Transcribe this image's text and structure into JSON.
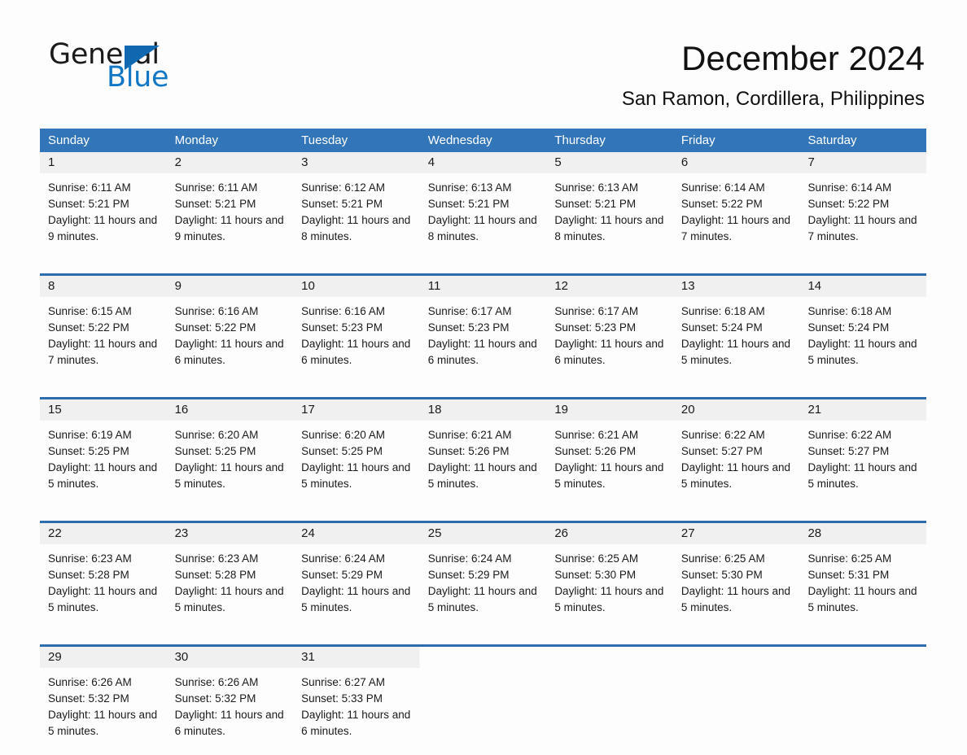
{
  "logo": {
    "word1": "General",
    "word2": "Blue",
    "triangle_color": "#1068b1",
    "blue_text_color": "#1278c6"
  },
  "header": {
    "title": "December 2024",
    "subtitle": "San Ramon, Cordillera, Philippines"
  },
  "theme": {
    "header_blue": "#3275b8",
    "week_rule_blue": "#2d6cad",
    "daynum_band": "#f0f0f0",
    "page_bg": "#fdfdfd"
  },
  "weekdays": [
    "Sunday",
    "Monday",
    "Tuesday",
    "Wednesday",
    "Thursday",
    "Friday",
    "Saturday"
  ],
  "weeks": [
    {
      "days": [
        {
          "num": "1",
          "sunrise": "Sunrise: 6:11 AM",
          "sunset": "Sunset: 5:21 PM",
          "daylight": "Daylight: 11 hours and 9 minutes."
        },
        {
          "num": "2",
          "sunrise": "Sunrise: 6:11 AM",
          "sunset": "Sunset: 5:21 PM",
          "daylight": "Daylight: 11 hours and 9 minutes."
        },
        {
          "num": "3",
          "sunrise": "Sunrise: 6:12 AM",
          "sunset": "Sunset: 5:21 PM",
          "daylight": "Daylight: 11 hours and 8 minutes."
        },
        {
          "num": "4",
          "sunrise": "Sunrise: 6:13 AM",
          "sunset": "Sunset: 5:21 PM",
          "daylight": "Daylight: 11 hours and 8 minutes."
        },
        {
          "num": "5",
          "sunrise": "Sunrise: 6:13 AM",
          "sunset": "Sunset: 5:21 PM",
          "daylight": "Daylight: 11 hours and 8 minutes."
        },
        {
          "num": "6",
          "sunrise": "Sunrise: 6:14 AM",
          "sunset": "Sunset: 5:22 PM",
          "daylight": "Daylight: 11 hours and 7 minutes."
        },
        {
          "num": "7",
          "sunrise": "Sunrise: 6:14 AM",
          "sunset": "Sunset: 5:22 PM",
          "daylight": "Daylight: 11 hours and 7 minutes."
        }
      ]
    },
    {
      "days": [
        {
          "num": "8",
          "sunrise": "Sunrise: 6:15 AM",
          "sunset": "Sunset: 5:22 PM",
          "daylight": "Daylight: 11 hours and 7 minutes."
        },
        {
          "num": "9",
          "sunrise": "Sunrise: 6:16 AM",
          "sunset": "Sunset: 5:22 PM",
          "daylight": "Daylight: 11 hours and 6 minutes."
        },
        {
          "num": "10",
          "sunrise": "Sunrise: 6:16 AM",
          "sunset": "Sunset: 5:23 PM",
          "daylight": "Daylight: 11 hours and 6 minutes."
        },
        {
          "num": "11",
          "sunrise": "Sunrise: 6:17 AM",
          "sunset": "Sunset: 5:23 PM",
          "daylight": "Daylight: 11 hours and 6 minutes."
        },
        {
          "num": "12",
          "sunrise": "Sunrise: 6:17 AM",
          "sunset": "Sunset: 5:23 PM",
          "daylight": "Daylight: 11 hours and 6 minutes."
        },
        {
          "num": "13",
          "sunrise": "Sunrise: 6:18 AM",
          "sunset": "Sunset: 5:24 PM",
          "daylight": "Daylight: 11 hours and 5 minutes."
        },
        {
          "num": "14",
          "sunrise": "Sunrise: 6:18 AM",
          "sunset": "Sunset: 5:24 PM",
          "daylight": "Daylight: 11 hours and 5 minutes."
        }
      ]
    },
    {
      "days": [
        {
          "num": "15",
          "sunrise": "Sunrise: 6:19 AM",
          "sunset": "Sunset: 5:25 PM",
          "daylight": "Daylight: 11 hours and 5 minutes."
        },
        {
          "num": "16",
          "sunrise": "Sunrise: 6:20 AM",
          "sunset": "Sunset: 5:25 PM",
          "daylight": "Daylight: 11 hours and 5 minutes."
        },
        {
          "num": "17",
          "sunrise": "Sunrise: 6:20 AM",
          "sunset": "Sunset: 5:25 PM",
          "daylight": "Daylight: 11 hours and 5 minutes."
        },
        {
          "num": "18",
          "sunrise": "Sunrise: 6:21 AM",
          "sunset": "Sunset: 5:26 PM",
          "daylight": "Daylight: 11 hours and 5 minutes."
        },
        {
          "num": "19",
          "sunrise": "Sunrise: 6:21 AM",
          "sunset": "Sunset: 5:26 PM",
          "daylight": "Daylight: 11 hours and 5 minutes."
        },
        {
          "num": "20",
          "sunrise": "Sunrise: 6:22 AM",
          "sunset": "Sunset: 5:27 PM",
          "daylight": "Daylight: 11 hours and 5 minutes."
        },
        {
          "num": "21",
          "sunrise": "Sunrise: 6:22 AM",
          "sunset": "Sunset: 5:27 PM",
          "daylight": "Daylight: 11 hours and 5 minutes."
        }
      ]
    },
    {
      "days": [
        {
          "num": "22",
          "sunrise": "Sunrise: 6:23 AM",
          "sunset": "Sunset: 5:28 PM",
          "daylight": "Daylight: 11 hours and 5 minutes."
        },
        {
          "num": "23",
          "sunrise": "Sunrise: 6:23 AM",
          "sunset": "Sunset: 5:28 PM",
          "daylight": "Daylight: 11 hours and 5 minutes."
        },
        {
          "num": "24",
          "sunrise": "Sunrise: 6:24 AM",
          "sunset": "Sunset: 5:29 PM",
          "daylight": "Daylight: 11 hours and 5 minutes."
        },
        {
          "num": "25",
          "sunrise": "Sunrise: 6:24 AM",
          "sunset": "Sunset: 5:29 PM",
          "daylight": "Daylight: 11 hours and 5 minutes."
        },
        {
          "num": "26",
          "sunrise": "Sunrise: 6:25 AM",
          "sunset": "Sunset: 5:30 PM",
          "daylight": "Daylight: 11 hours and 5 minutes."
        },
        {
          "num": "27",
          "sunrise": "Sunrise: 6:25 AM",
          "sunset": "Sunset: 5:30 PM",
          "daylight": "Daylight: 11 hours and 5 minutes."
        },
        {
          "num": "28",
          "sunrise": "Sunrise: 6:25 AM",
          "sunset": "Sunset: 5:31 PM",
          "daylight": "Daylight: 11 hours and 5 minutes."
        }
      ]
    },
    {
      "days": [
        {
          "num": "29",
          "sunrise": "Sunrise: 6:26 AM",
          "sunset": "Sunset: 5:32 PM",
          "daylight": "Daylight: 11 hours and 5 minutes."
        },
        {
          "num": "30",
          "sunrise": "Sunrise: 6:26 AM",
          "sunset": "Sunset: 5:32 PM",
          "daylight": "Daylight: 11 hours and 6 minutes."
        },
        {
          "num": "31",
          "sunrise": "Sunrise: 6:27 AM",
          "sunset": "Sunset: 5:33 PM",
          "daylight": "Daylight: 11 hours and 6 minutes."
        },
        {
          "num": "",
          "sunrise": "",
          "sunset": "",
          "daylight": ""
        },
        {
          "num": "",
          "sunrise": "",
          "sunset": "",
          "daylight": ""
        },
        {
          "num": "",
          "sunrise": "",
          "sunset": "",
          "daylight": ""
        },
        {
          "num": "",
          "sunrise": "",
          "sunset": "",
          "daylight": ""
        }
      ]
    }
  ]
}
